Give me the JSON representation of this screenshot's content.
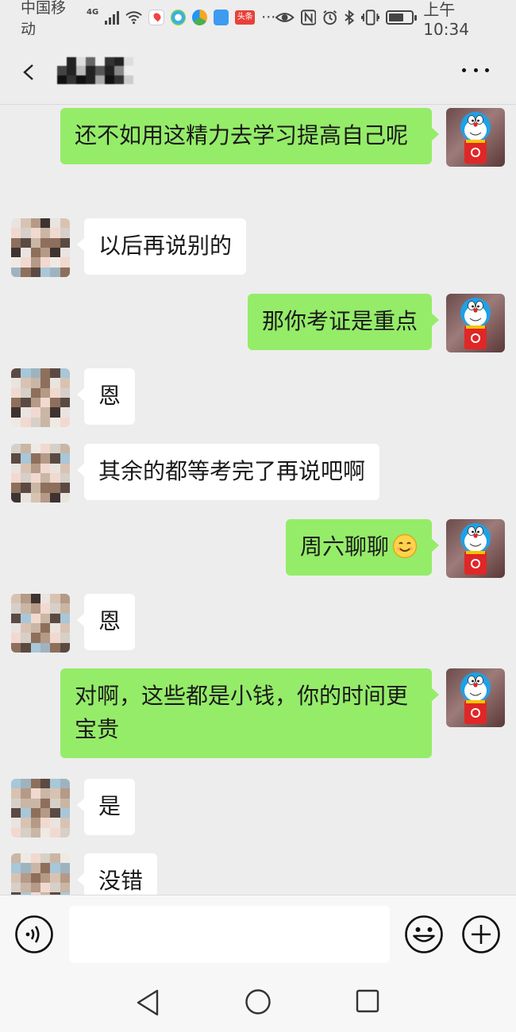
{
  "status_bar": {
    "carrier": "中国移动",
    "network": "4G",
    "toutiao_label": "头条",
    "overflow": "···",
    "time": "上午10:34",
    "battery_level": 0.7,
    "icons": [
      "signal-icon",
      "wifi-icon",
      "app-notification-icons",
      "eye-comfort-icon",
      "nfc-icon",
      "alarm-icon",
      "bluetooth-icon",
      "vibrate-icon",
      "battery-icon"
    ]
  },
  "title_bar": {
    "back_icon": "chevron-left-icon",
    "title": "",
    "more_icon": "more-horizontal-icon"
  },
  "messages": [
    {
      "side": "right",
      "text": "还不如用这精力去学习提高自己呢"
    },
    {
      "side": "left",
      "text": "以后再说别的"
    },
    {
      "side": "right",
      "text": "那你考证是重点"
    },
    {
      "side": "left",
      "text": "恩"
    },
    {
      "side": "left",
      "text": "其余的都等考完了再说吧啊"
    },
    {
      "side": "right",
      "text": "周六聊聊",
      "emoji": "smile-emoji"
    },
    {
      "side": "left",
      "text": "恩"
    },
    {
      "side": "right",
      "text": "对啊，这些都是小钱，你的时间更宝贵"
    },
    {
      "side": "left",
      "text": "是"
    },
    {
      "side": "left",
      "text": "没错"
    }
  ],
  "input_bar": {
    "voice_icon": "voice-icon",
    "input_value": "",
    "emoji_icon": "emoji-icon",
    "plus_icon": "plus-icon"
  },
  "nav_bar": {
    "icons": [
      "nav-back-icon",
      "nav-home-icon",
      "nav-recent-icon"
    ]
  },
  "colors": {
    "background": "#ededed",
    "own_bubble": "#95ec69",
    "other_bubble": "#ffffff",
    "doraemon_blue": "#1ea1e6",
    "doraemon_red": "#e02626"
  }
}
